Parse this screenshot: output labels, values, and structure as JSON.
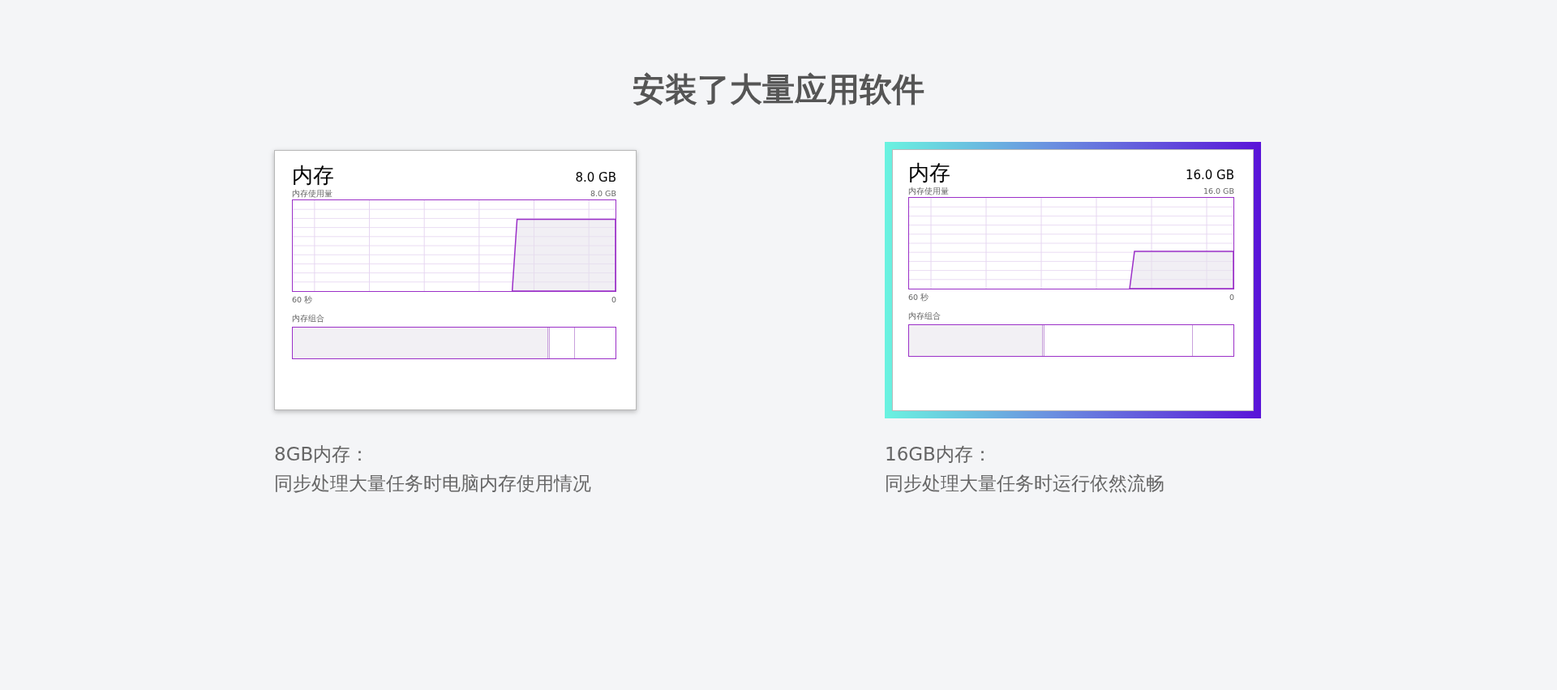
{
  "title": "安装了大量应用软件",
  "cards": [
    {
      "highlighted": false,
      "heading": "内存",
      "total": "8.0 GB",
      "usage": {
        "label": "内存使用量",
        "max": "8.0 GB"
      },
      "axis_start": "60 秒",
      "axis_end": "0",
      "composition": {
        "label": "内存组合",
        "level": 0.79
      },
      "caption": [
        "8GB内存：",
        "同步处理大量任务时电脑内存使用情况"
      ]
    },
    {
      "highlighted": true,
      "heading": "内存",
      "total": "16.0 GB",
      "usage": {
        "label": "内存使用量",
        "max": "16.0 GB"
      },
      "axis_start": "60 秒",
      "axis_end": "0",
      "composition": {
        "label": "内存组合",
        "level": 0.41
      },
      "caption": [
        "16GB内存：",
        "同步处理大量任务时运行依然流畅"
      ]
    }
  ]
}
